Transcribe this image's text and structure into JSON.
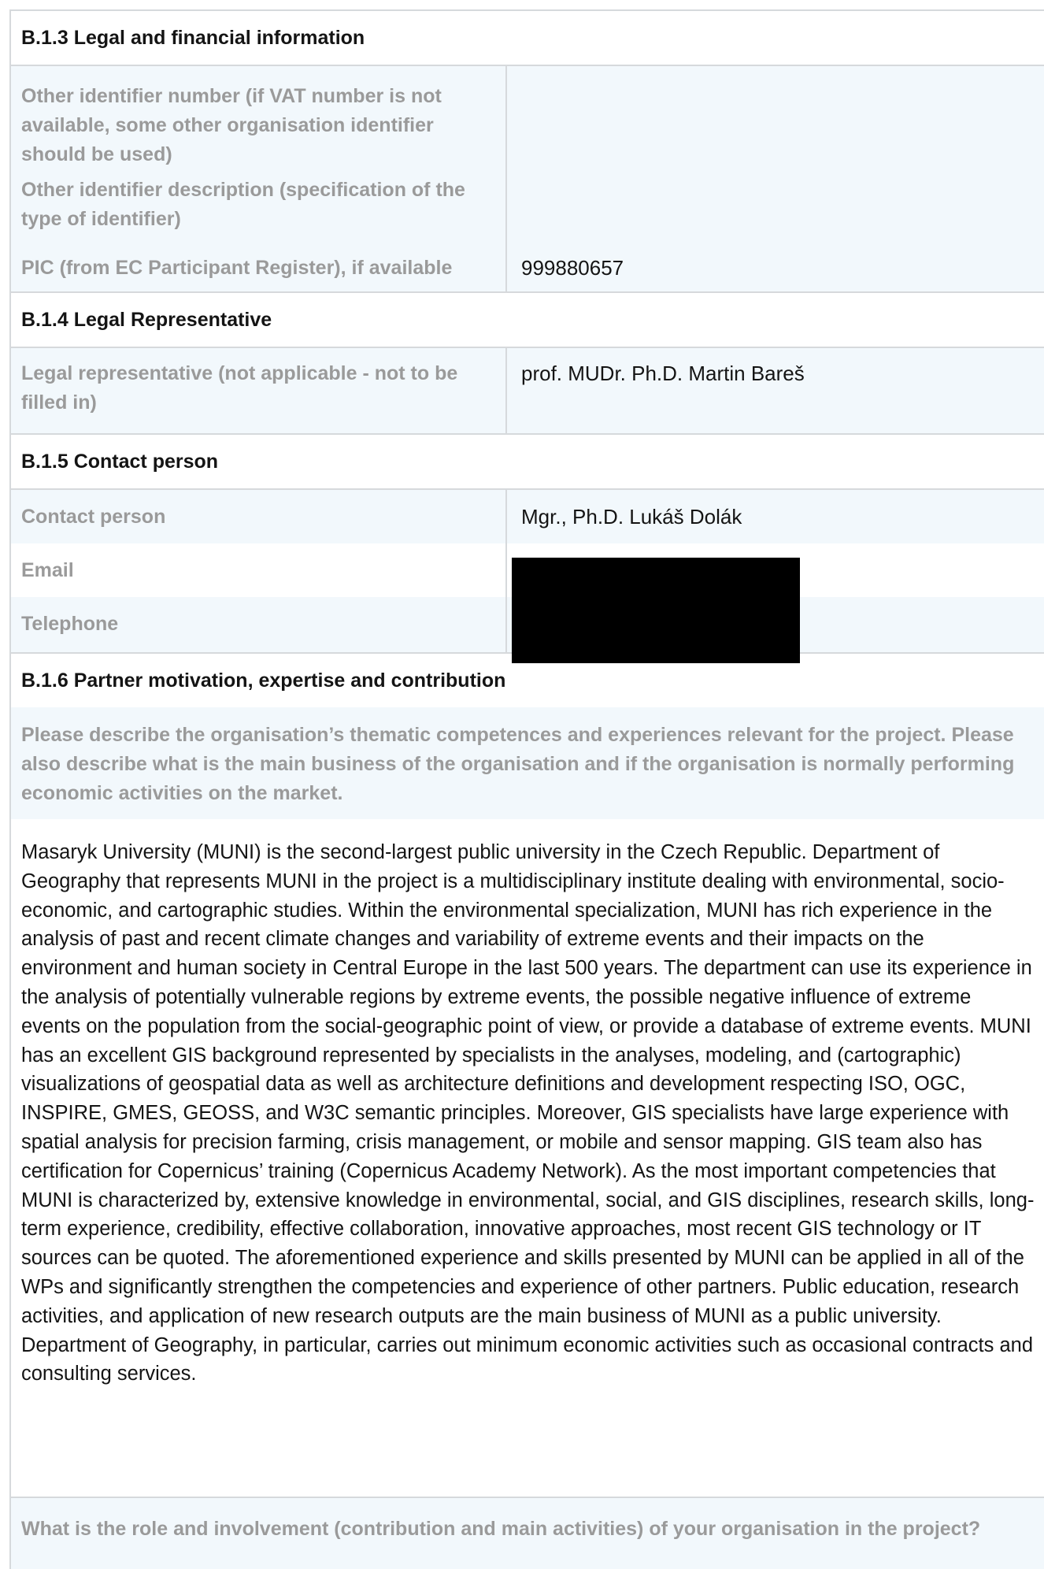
{
  "sections": {
    "b13": {
      "heading": "B.1.3 Legal and financial information",
      "rows": [
        {
          "label": "Other identifier number (if VAT number is not available, some other organisation identifier should be used)",
          "value": ""
        },
        {
          "label": "Other identifier description (specification of the type of identifier)",
          "value": ""
        },
        {
          "label": "PIC (from EC Participant Register), if available",
          "value": "999880657"
        }
      ]
    },
    "b14": {
      "heading": "B.1.4 Legal Representative",
      "rows": [
        {
          "label": "Legal representative (not applicable - not to be filled in)",
          "value": "prof. MUDr. Ph.D. Martin Bareš"
        }
      ]
    },
    "b15": {
      "heading": "B.1.5 Contact person",
      "rows": [
        {
          "label": "Contact person",
          "value": "Mgr., Ph.D. Lukáš Dolák"
        },
        {
          "label": "Email",
          "value": ""
        },
        {
          "label": "Telephone",
          "value": ""
        }
      ]
    },
    "b16": {
      "heading": "B.1.6 Partner motivation, expertise and contribution",
      "question1": "Please describe the organisation’s thematic competences and experiences relevant for the project. Please also describe what is the main business of the organisation and if the organisation is normally performing economic activities on the market.",
      "answer1": "Masaryk University (MUNI) is the second-largest public university in the Czech Republic. Department of Geography that represents MUNI in the project is a multidisciplinary institute dealing with environmental, socio-economic, and cartographic studies. Within the environmental specialization, MUNI has rich experience in the analysis of past and recent climate changes and variability of extreme events and their impacts on the environment and human society in Central Europe in the last 500 years. The department can use its experience in the analysis of potentially vulnerable regions by extreme events, the possible negative influence of extreme events on the population from the social-geographic point of view, or provide a database of extreme events. MUNI has an excellent GIS background represented by specialists in the analyses, modeling, and (cartographic) visualizations of geospatial data as well as architecture definitions and development respecting ISO, OGC, INSPIRE, GMES, GEOSS, and W3C semantic principles. Moreover, GIS specialists have large experience with spatial analysis for precision farming, crisis management, or mobile and sensor mapping. GIS team also has certification for Copernicus’ training (Copernicus Academy Network). As the most important competencies that MUNI is characterized by, extensive knowledge in environmental, social, and GIS disciplines, research skills, long-term experience, credibility, effective collaboration, innovative approaches, most recent GIS technology or IT sources can be quoted. The aforementioned experience and skills presented by MUNI can be applied in all of the WPs and significantly strengthen the competencies and experience of other partners. Public education, research activities, and application of new research outputs are the main business of MUNI as a public university. Department of Geography, in particular, carries out minimum economic activities such as occasional contracts and consulting services.",
      "question2": "What is the role and involvement (contribution and main activities) of your organisation in the project?"
    }
  }
}
